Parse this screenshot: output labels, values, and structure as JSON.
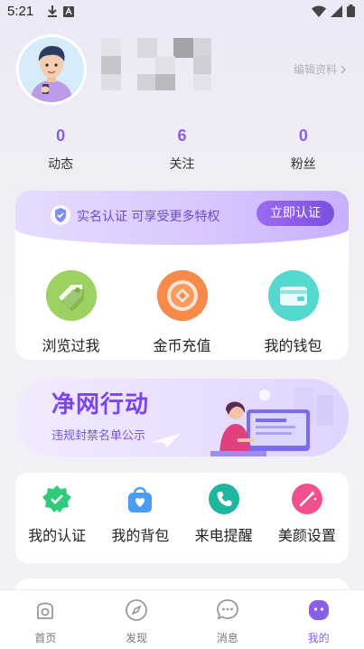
{
  "status_bar": {
    "time": "5:21"
  },
  "profile": {
    "edit_label": "编辑资料"
  },
  "stats": [
    {
      "value": "0",
      "label": "动态"
    },
    {
      "value": "6",
      "label": "关注"
    },
    {
      "value": "0",
      "label": "粉丝"
    }
  ],
  "verify": {
    "text": "实名认证 可享受更多特权",
    "button": "立即认证"
  },
  "features": [
    {
      "label": "浏览过我",
      "icon": "tag-icon",
      "color": "#8cc152"
    },
    {
      "label": "金币充值",
      "icon": "coin-icon",
      "color": "#f58a4b"
    },
    {
      "label": "我的钱包",
      "icon": "wallet-icon",
      "color": "#4fd6cc"
    }
  ],
  "promo": {
    "title": "净网行动",
    "subtitle": "违规封禁名单公示"
  },
  "tools": [
    {
      "label": "我的认证",
      "icon": "verified-badge-icon",
      "color": "#2ecc71"
    },
    {
      "label": "我的背包",
      "icon": "shopping-bag-icon",
      "color": "#4a9cf5"
    },
    {
      "label": "来电提醒",
      "icon": "phone-icon",
      "color": "#1fb5a0"
    },
    {
      "label": "美颜设置",
      "icon": "magic-wand-icon",
      "color": "#f0508e"
    }
  ],
  "nav": [
    {
      "label": "首页",
      "icon": "home-icon"
    },
    {
      "label": "发现",
      "icon": "compass-icon"
    },
    {
      "label": "消息",
      "icon": "chat-icon"
    },
    {
      "label": "我的",
      "icon": "profile-icon",
      "active": true
    }
  ],
  "colors": {
    "accent": "#8a5fe8"
  }
}
